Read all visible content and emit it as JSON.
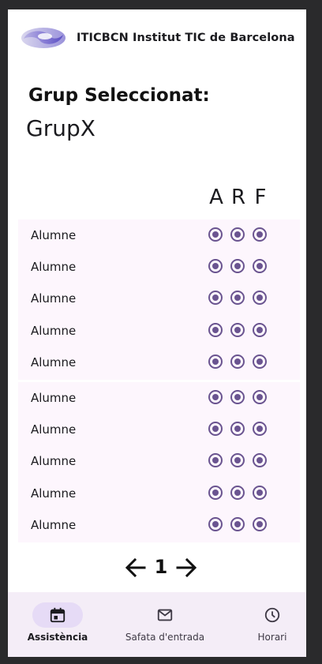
{
  "header": {
    "title": "ITICBCN Institut TIC de Barcelona"
  },
  "group": {
    "label": "Grup Seleccionat:",
    "name": "GrupX"
  },
  "columns": [
    "A",
    "R",
    "F"
  ],
  "cards": [
    {
      "students": [
        "Alumne",
        "Alumne",
        "Alumne",
        "Alumne",
        "Alumne"
      ]
    },
    {
      "students": [
        "Alumne",
        "Alumne",
        "Alumne",
        "Alumne",
        "Alumne"
      ]
    }
  ],
  "pagination": {
    "current_page": "1"
  },
  "navbar": {
    "items": [
      {
        "label": "Assistència",
        "icon": "calendar-icon",
        "active": true
      },
      {
        "label": "Safata d'entrada",
        "icon": "mail-icon",
        "active": false
      },
      {
        "label": "Horari",
        "icon": "clock-icon",
        "active": false
      }
    ]
  },
  "colors": {
    "accent": "#6a5490",
    "card_bg": "#fdf6fd",
    "navbar_bg": "#f4edf7",
    "active_pill": "#e6dbf6"
  }
}
